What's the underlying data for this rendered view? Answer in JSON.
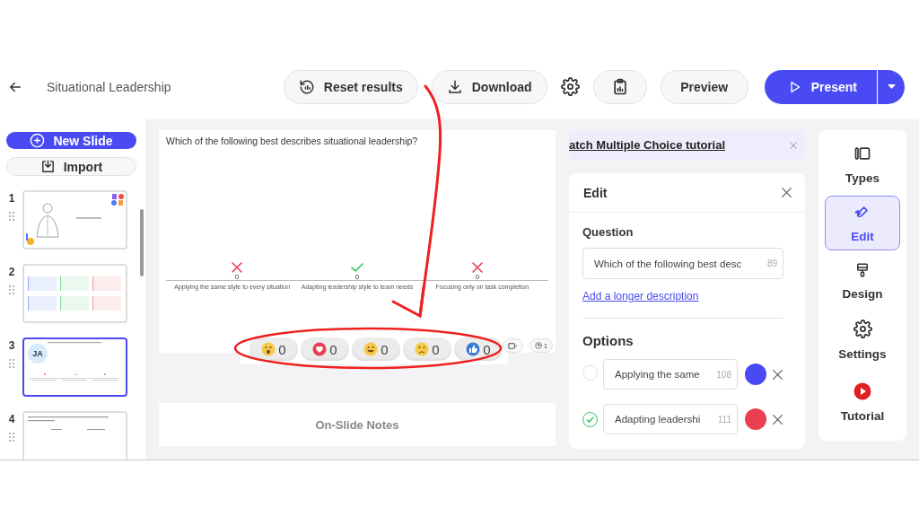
{
  "header": {
    "title": "Situational Leadership",
    "actions": [
      {
        "kind": "reset",
        "label": "Reset results"
      },
      {
        "kind": "download",
        "label": "Download"
      },
      {
        "kind": "gear"
      },
      {
        "kind": "clipboard"
      },
      {
        "kind": "text",
        "label": "Preview"
      }
    ],
    "present": {
      "label": "Present"
    }
  },
  "sidebar": {
    "new_slide": "New Slide",
    "import": "Import",
    "slides": [
      {
        "number": "1",
        "kind": "title",
        "selected": false
      },
      {
        "number": "2",
        "kind": "grid",
        "selected": false
      },
      {
        "number": "3",
        "kind": "results",
        "selected": true,
        "avatar": "JA"
      },
      {
        "number": "4",
        "kind": "columns",
        "selected": false
      }
    ]
  },
  "slide": {
    "question": "Which of the following best describes situational leadership?",
    "results": [
      {
        "correct": false,
        "count": "0",
        "label": "Applying the same style to every situation"
      },
      {
        "correct": true,
        "count": "0",
        "label": "Adapting leadership style to team needs"
      },
      {
        "correct": false,
        "count": "0",
        "label": "Focusing only on task completion"
      }
    ],
    "reactions": [
      {
        "kind": "wow",
        "count": "0"
      },
      {
        "kind": "heart",
        "count": "0"
      },
      {
        "kind": "laugh",
        "count": "0"
      },
      {
        "kind": "sad",
        "count": "0"
      },
      {
        "kind": "like",
        "count": "0"
      }
    ],
    "participants": "1"
  },
  "notes": "On-Slide Notes",
  "tutorial_banner": "atch Multiple Choice tutorial",
  "edit_panel": {
    "title": "Edit",
    "question_label": "Question",
    "question_value": "Which of the following best desc",
    "question_count": "89",
    "link": "Add a longer description",
    "options_label": "Options",
    "options": [
      {
        "text": "Applying the same",
        "count": "108",
        "correct": false,
        "color": "#4a4af4"
      },
      {
        "text": "Adapting leadershi",
        "count": "111",
        "correct": true,
        "color": "#e8404f"
      }
    ]
  },
  "tools": [
    {
      "kind": "types",
      "label": "Types",
      "selected": false
    },
    {
      "kind": "edit",
      "label": "Edit",
      "selected": true
    },
    {
      "kind": "design",
      "label": "Design",
      "selected": false
    },
    {
      "kind": "settings",
      "label": "Settings",
      "selected": false
    },
    {
      "kind": "tutorial",
      "label": "Tutorial",
      "selected": false
    }
  ]
}
